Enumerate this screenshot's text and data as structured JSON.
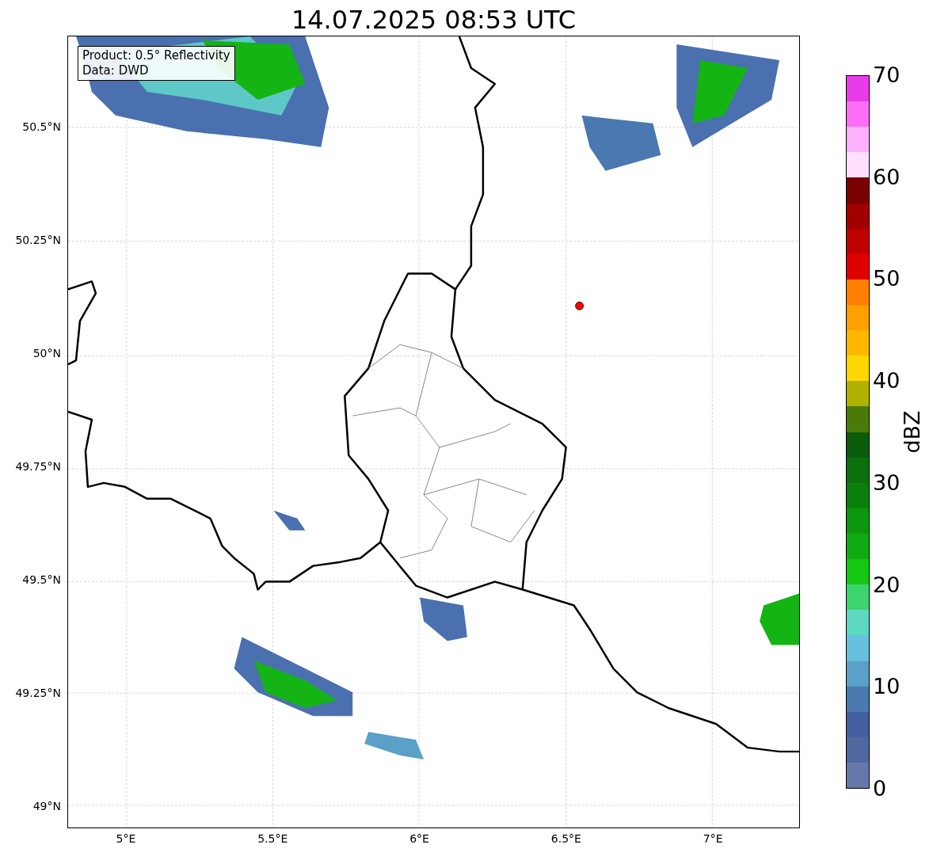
{
  "title": "14.07.2025 08:53 UTC",
  "info_box": [
    "Product: 0.5° Reflectivity",
    "Data: DWD"
  ],
  "y_ticks": [
    "50.5°N",
    "50.25°N",
    "50°N",
    "49.75°N",
    "49.5°N",
    "49.25°N",
    "49°N"
  ],
  "x_ticks": [
    "5°E",
    "5.5°E",
    "6°E",
    "6.5°E",
    "7°E"
  ],
  "colorbar": {
    "label": "dBZ",
    "ticks": [
      "70",
      "60",
      "50",
      "40",
      "30",
      "20",
      "10",
      "0"
    ],
    "bands": [
      {
        "color": "#e83ce8"
      },
      {
        "color": "#ff6ef7"
      },
      {
        "color": "#ffb0ff"
      },
      {
        "color": "#ffe0ff"
      },
      {
        "color": "#7a0000"
      },
      {
        "color": "#a00000"
      },
      {
        "color": "#c00000"
      },
      {
        "color": "#e00000"
      },
      {
        "color": "#ff7f00"
      },
      {
        "color": "#ff9f00"
      },
      {
        "color": "#ffb800"
      },
      {
        "color": "#ffd700"
      },
      {
        "color": "#b0b000"
      },
      {
        "color": "#4a7a0a"
      },
      {
        "color": "#0a5c0a"
      },
      {
        "color": "#0c700c"
      },
      {
        "color": "#0c800c"
      },
      {
        "color": "#0f960f"
      },
      {
        "color": "#12aa12"
      },
      {
        "color": "#14c814"
      },
      {
        "color": "#3cd46e"
      },
      {
        "color": "#5ed8c0"
      },
      {
        "color": "#68c0e0"
      },
      {
        "color": "#5aa0c8"
      },
      {
        "color": "#4a7ab0"
      },
      {
        "color": "#4460a0"
      },
      {
        "color": "#5068a0"
      },
      {
        "color": "#6677aa"
      }
    ]
  }
}
